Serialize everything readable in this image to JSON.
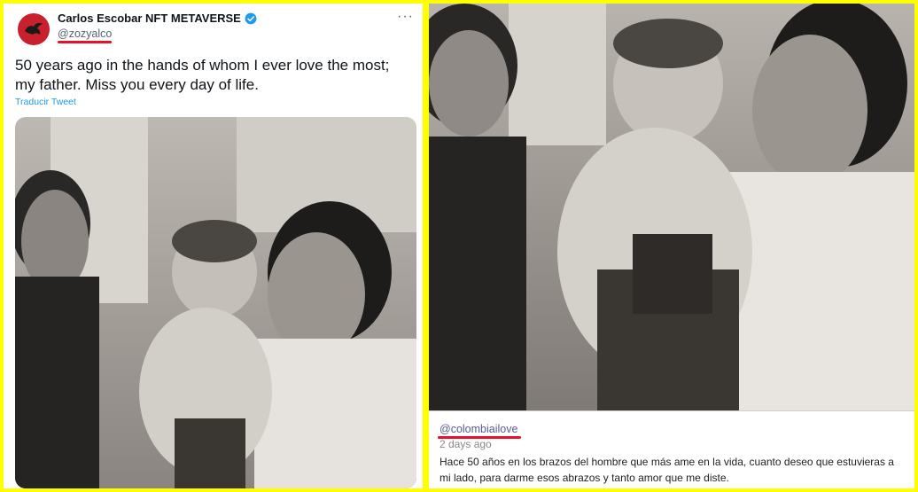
{
  "tweet": {
    "display_name": "Carlos Escobar NFT METAVERSE",
    "handle": "@zozyalco",
    "text": "50 years ago in the hands of whom I ever love the most; my father. Miss you every day of life.",
    "translate_label": "Traducir Tweet",
    "more_label": "···"
  },
  "caption": {
    "handle": "@colombiailove",
    "date": "2 days ago",
    "text": "Hace 50 años en los brazos del hombre que más ame en la vida, cuanto deseo que estuvieras a mi lado, para darme esos abrazos y tanto amor que me diste."
  },
  "colors": {
    "frame": "#ffff00",
    "underline": "#e8102a",
    "link": "#1d9bf0",
    "verified": "#1d9bf0",
    "avatar_bg": "#c8202c"
  },
  "icons": [
    "avatar-bird-icon",
    "verified-badge-icon",
    "more-options-icon"
  ]
}
